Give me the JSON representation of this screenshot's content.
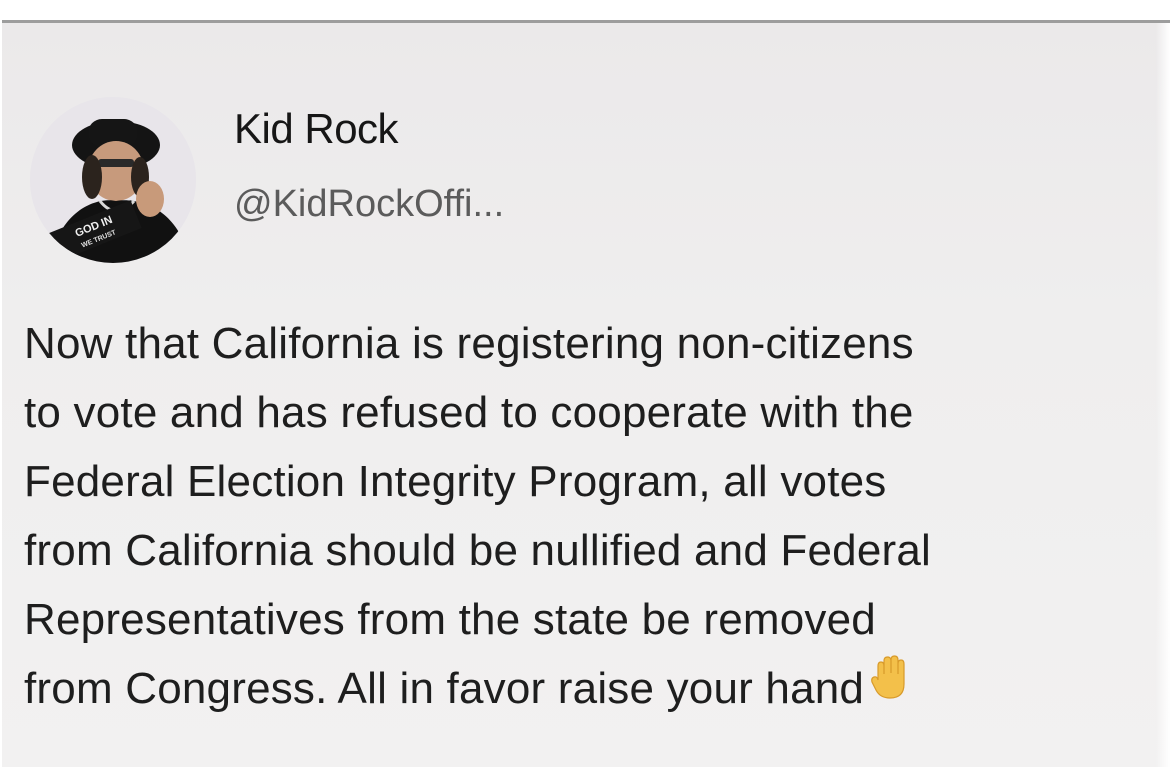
{
  "tweet": {
    "author_name": "Kid Rock",
    "author_handle": "@KidRockOffi...",
    "avatar_icon": "profile-photo",
    "lines": [
      "Now that California is registering non-citizens",
      "to vote and has refused to cooperate with the",
      "Federal Election Integrity Program, all votes",
      "from California should be nullified and Federal",
      "Representatives from the state be removed",
      "from Congress. All in favor raise your hand"
    ],
    "emoji": "raised-hand-emoji",
    "avatar_hat_text": "GOD IN",
    "avatar_hat_text_2": "WE TRUST"
  }
}
